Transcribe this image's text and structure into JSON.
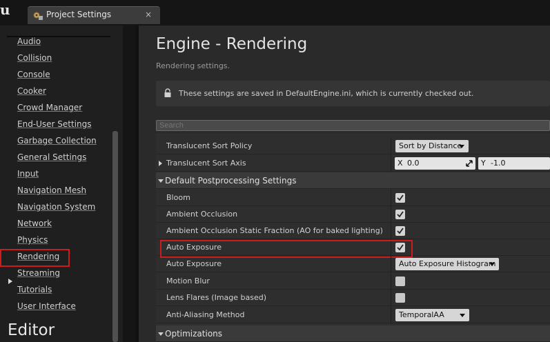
{
  "titlebar": {
    "logo": "u",
    "tab_label": "Project Settings",
    "close": "×"
  },
  "sidebar": {
    "items": [
      "Audio",
      "Collision",
      "Console",
      "Cooker",
      "Crowd Manager",
      "End-User Settings",
      "Garbage Collection",
      "General Settings",
      "Input",
      "Navigation Mesh",
      "Navigation System",
      "Network",
      "Physics",
      "Rendering",
      "Streaming",
      "Tutorials",
      "User Interface"
    ],
    "selected": "Rendering",
    "section_heading": "Editor"
  },
  "main": {
    "title": "Engine - Rendering",
    "subtitle": "Rendering settings.",
    "notice": "These settings are saved in DefaultEngine.ini, which is currently checked out.",
    "search_placeholder": "Search",
    "rows": {
      "translucent_sort_policy": {
        "label": "Translucent Sort Policy",
        "value": "Sort by Distance"
      },
      "translucent_sort_axis": {
        "label": "Translucent Sort Axis",
        "x_axis": "X",
        "x_value": "0.0",
        "y_axis": "Y",
        "y_value": "-1.0"
      },
      "cat_postprocessing": "Default Postprocessing Settings",
      "bloom": {
        "label": "Bloom",
        "checked": true
      },
      "ambient_occlusion": {
        "label": "Ambient Occlusion",
        "checked": true
      },
      "ao_static_fraction": {
        "label": "Ambient Occlusion Static Fraction (AO for baked lighting)",
        "checked": true
      },
      "auto_exposure_check": {
        "label": "Auto Exposure",
        "checked": true
      },
      "auto_exposure_method": {
        "label": "Auto Exposure",
        "value": "Auto Exposure Histogram"
      },
      "motion_blur": {
        "label": "Motion Blur",
        "checked": false
      },
      "lens_flares": {
        "label": "Lens Flares (Image based)",
        "checked": false
      },
      "anti_aliasing": {
        "label": "Anti-Aliasing Method",
        "value": "TemporalAA"
      },
      "cat_optimizations": "Optimizations"
    }
  },
  "colors": {
    "highlight": "#d11a1a",
    "panel": "#2e2e2e",
    "sidebar": "#1f1f1f"
  }
}
